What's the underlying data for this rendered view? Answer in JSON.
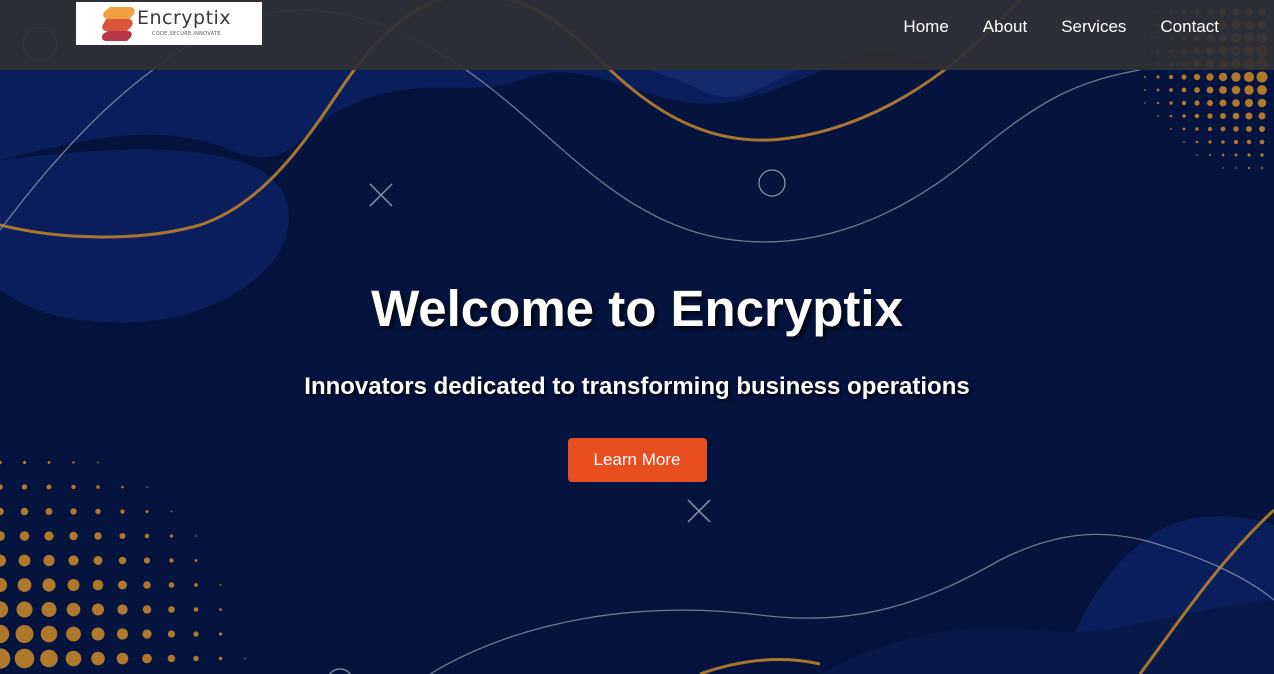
{
  "brand": {
    "name": "Encryptix",
    "tagline": "CODE.SECURE.INNOVATE"
  },
  "nav": {
    "items": [
      {
        "label": "Home"
      },
      {
        "label": "About"
      },
      {
        "label": "Services"
      },
      {
        "label": "Contact"
      }
    ]
  },
  "hero": {
    "title": "Welcome to Encryptix",
    "subtitle": "Innovators dedicated to transforming business operations",
    "cta_label": "Learn More"
  },
  "colors": {
    "background": "#04143f",
    "wave_blue": "#0b1e5c",
    "gold_accent": "#b0782a",
    "navbar": "#303034",
    "cta": "#e84e1f",
    "logo_red": "#c9413c",
    "logo_orange": "#f0a040"
  },
  "icons": {
    "logo_mark": "s-ribbon-logo-icon",
    "decor_cross": "cross-icon",
    "decor_circle": "circle-outline-icon"
  }
}
